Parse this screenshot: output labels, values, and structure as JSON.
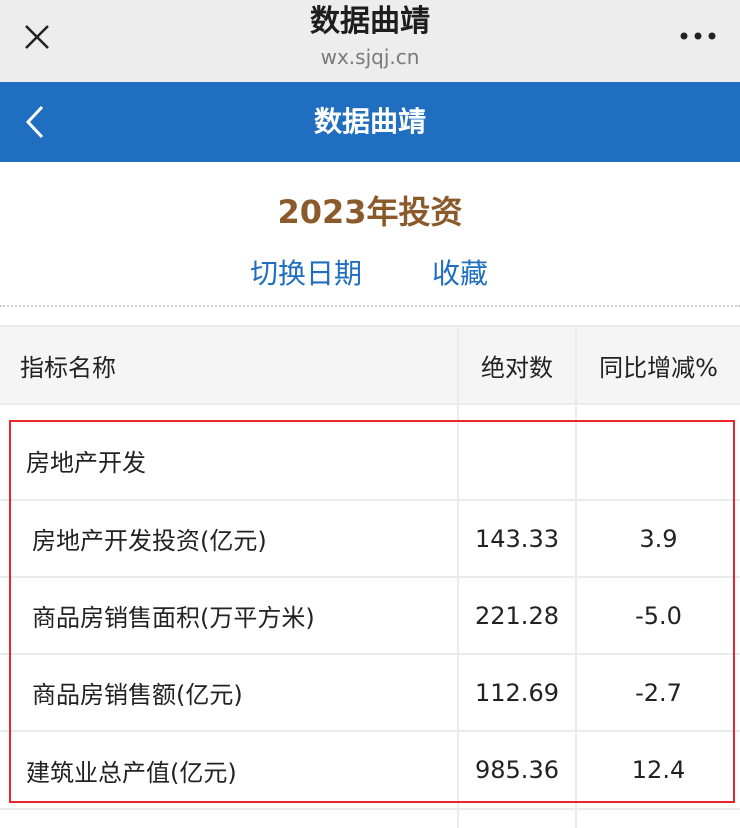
{
  "browser": {
    "title": "数据曲靖",
    "url": "wx.sjqj.cn"
  },
  "header": {
    "title": "数据曲靖"
  },
  "page": {
    "title": "2023年投资",
    "switch_date_label": "切换日期",
    "favorite_label": "收藏"
  },
  "table": {
    "columns": [
      "指标名称",
      "绝对数",
      "同比增减%"
    ],
    "rows": [
      {
        "name": "房地产开发",
        "abs": "",
        "yoy": ""
      },
      {
        "name": "房地产开发投资(亿元)",
        "abs": "143.33",
        "yoy": "3.9"
      },
      {
        "name": "商品房销售面积(万平方米)",
        "abs": "221.28",
        "yoy": "-5.0"
      },
      {
        "name": "商品房销售额(亿元)",
        "abs": "112.69",
        "yoy": "-2.7"
      },
      {
        "name": "建筑业总产值(亿元)",
        "abs": "985.36",
        "yoy": "12.4"
      }
    ]
  },
  "colors": {
    "header_bg": "#1f6ebf",
    "title_color": "#8b5a2b",
    "link_color": "#1f6ebf",
    "highlight": "#e8262b"
  }
}
